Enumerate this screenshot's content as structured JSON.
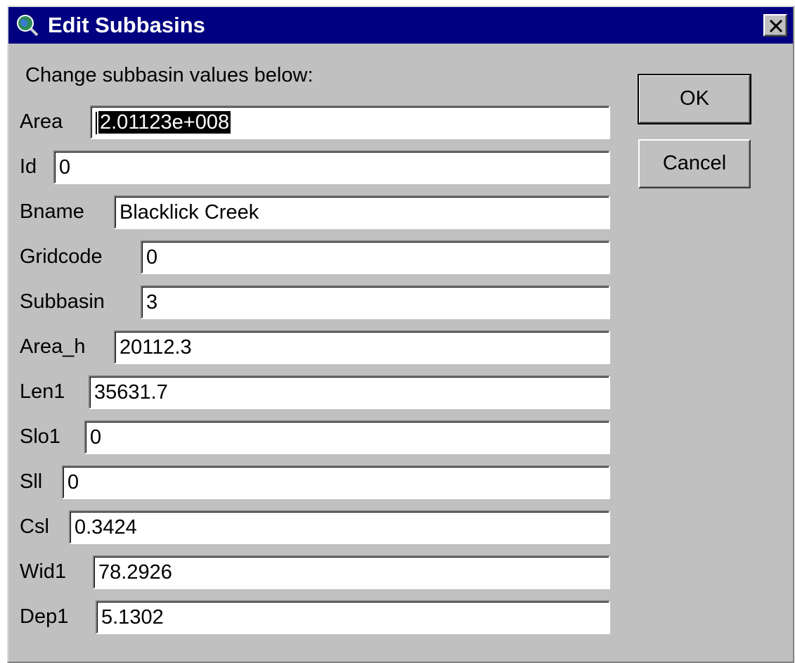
{
  "window": {
    "title": "Edit Subbasins",
    "icon": "globe-magnifier-icon",
    "close_icon": "close-icon"
  },
  "instruction": "Change subbasin values below:",
  "fields": [
    {
      "label": "Area",
      "value": "2.01123e+008",
      "selected": true
    },
    {
      "label": "Id",
      "value": "0"
    },
    {
      "label": "Bname",
      "value": "Blacklick Creek"
    },
    {
      "label": "Gridcode",
      "value": "0"
    },
    {
      "label": "Subbasin",
      "value": "3"
    },
    {
      "label": "Area_h",
      "value": "20112.3"
    },
    {
      "label": "Len1",
      "value": "35631.7"
    },
    {
      "label": "Slo1",
      "value": "0"
    },
    {
      "label": "Sll",
      "value": "0"
    },
    {
      "label": "Csl",
      "value": "0.3424"
    },
    {
      "label": "Wid1",
      "value": "78.2926"
    },
    {
      "label": "Dep1",
      "value": "5.1302"
    }
  ],
  "buttons": {
    "ok": "OK",
    "cancel": "Cancel"
  },
  "colors": {
    "titlebar": "#000080",
    "face": "#c0c0c0"
  }
}
